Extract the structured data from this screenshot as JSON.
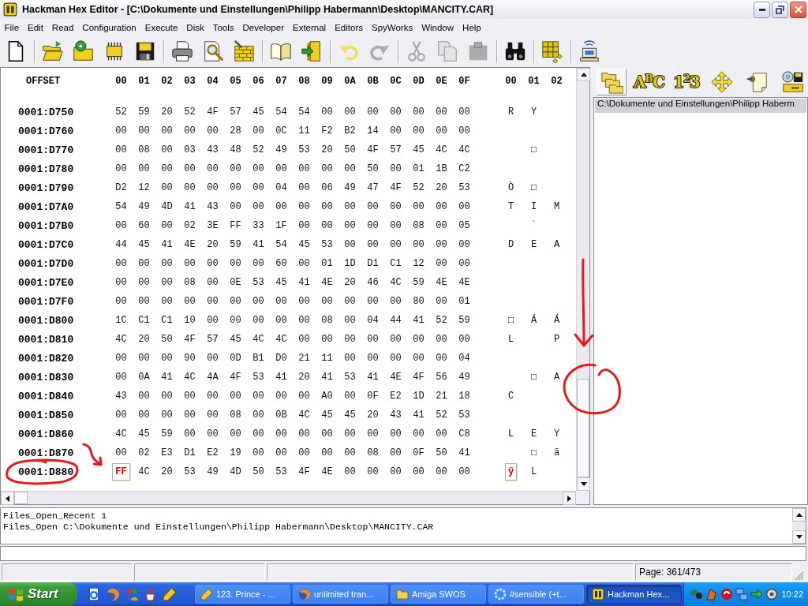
{
  "window": {
    "title": "Hackman Hex Editor - [C:\\Dokumente und Einstellungen\\Philipp Habermann\\Desktop\\MANCITY.CAR]"
  },
  "menu": [
    "File",
    "Edit",
    "Read",
    "Configuration",
    "Execute",
    "Disk",
    "Tools",
    "Developer",
    "External",
    "Editors",
    "SpyWorks",
    "Window",
    "Help"
  ],
  "toolbar": {
    "groups": [
      [
        {
          "kind": "new",
          "disabled": false
        }
      ],
      [
        {
          "kind": "open",
          "disabled": false
        },
        {
          "kind": "recent",
          "disabled": false
        },
        {
          "kind": "chip",
          "disabled": false
        },
        {
          "kind": "save",
          "disabled": false
        }
      ],
      [
        {
          "kind": "print",
          "disabled": false
        },
        {
          "kind": "inspect",
          "disabled": false
        },
        {
          "kind": "wall",
          "disabled": false
        }
      ],
      [
        {
          "kind": "book",
          "disabled": false
        },
        {
          "kind": "exit",
          "disabled": false
        }
      ],
      [
        {
          "kind": "undo",
          "disabled": false
        },
        {
          "kind": "redo",
          "disabled": true
        }
      ],
      [
        {
          "kind": "cut",
          "disabled": true
        },
        {
          "kind": "copy",
          "disabled": true
        },
        {
          "kind": "paste",
          "disabled": true
        }
      ],
      [
        {
          "kind": "find",
          "disabled": false
        }
      ],
      [
        {
          "kind": "cubes",
          "disabled": false
        }
      ],
      [
        {
          "kind": "network",
          "disabled": false
        }
      ]
    ]
  },
  "hex_view": {
    "offset_header": "OFFSET",
    "byte_columns": [
      "00",
      "01",
      "02",
      "03",
      "04",
      "05",
      "06",
      "07",
      "08",
      "09",
      "0A",
      "0B",
      "0C",
      "0D",
      "0E",
      "0F"
    ],
    "text_columns": [
      "00",
      "01",
      "02"
    ],
    "rows": [
      {
        "offset": "0001:D750",
        "bytes": [
          {
            "value": "52",
            "selected": false
          },
          {
            "value": "59",
            "selected": false
          },
          {
            "value": "20",
            "selected": false
          },
          {
            "value": "52",
            "selected": false
          },
          {
            "value": "4F",
            "selected": false
          },
          {
            "value": "57",
            "selected": false
          },
          {
            "value": "45",
            "selected": false
          },
          {
            "value": "54",
            "selected": false
          },
          {
            "value": "54",
            "selected": false
          },
          {
            "value": "00",
            "selected": false
          },
          {
            "value": "00",
            "selected": false
          },
          {
            "value": "00",
            "selected": false
          },
          {
            "value": "00",
            "selected": false
          },
          {
            "value": "00",
            "selected": false
          },
          {
            "value": "00",
            "selected": false
          },
          {
            "value": "00",
            "selected": false
          }
        ],
        "text": [
          {
            "value": "R",
            "selected": false
          },
          {
            "value": "Y",
            "selected": false
          },
          {
            "selected": false
          }
        ]
      },
      {
        "offset": "0001:D760",
        "bytes": [
          {
            "value": "00",
            "selected": false
          },
          {
            "value": "00",
            "selected": false
          },
          {
            "value": "00",
            "selected": false
          },
          {
            "value": "00",
            "selected": false
          },
          {
            "value": "00",
            "selected": false
          },
          {
            "value": "28",
            "selected": false
          },
          {
            "value": "00",
            "selected": false
          },
          {
            "value": "0C",
            "selected": false
          },
          {
            "value": "11",
            "selected": false
          },
          {
            "value": "F2",
            "selected": false
          },
          {
            "value": "B2",
            "selected": false
          },
          {
            "value": "14",
            "selected": false
          },
          {
            "value": "00",
            "selected": false
          },
          {
            "value": "00",
            "selected": false
          },
          {
            "value": "00",
            "selected": false
          },
          {
            "value": "00",
            "selected": false
          }
        ]
      },
      {
        "offset": "0001:D770",
        "bytes": [
          {
            "value": "00",
            "selected": false
          },
          {
            "value": "08",
            "selected": false
          },
          {
            "value": "00",
            "selected": false
          },
          {
            "value": "03",
            "selected": false
          },
          {
            "value": "43",
            "selected": false
          },
          {
            "value": "48",
            "selected": false
          },
          {
            "value": "52",
            "selected": false
          },
          {
            "value": "49",
            "selected": false
          },
          {
            "value": "53",
            "selected": false
          },
          {
            "value": "20",
            "selected": false
          },
          {
            "value": "50",
            "selected": false
          },
          {
            "value": "4F",
            "selected": false
          },
          {
            "value": "57",
            "selected": false
          },
          {
            "value": "45",
            "selected": false
          },
          {
            "value": "4C",
            "selected": false
          },
          {
            "value": "4C",
            "selected": false
          }
        ],
        "text": [
          {
            "selected": false
          },
          {
            "value": "□",
            "selected": false
          },
          {
            "selected": false
          }
        ]
      },
      {
        "offset": "0001:D780",
        "bytes": [
          {
            "value": "00",
            "selected": false
          },
          {
            "value": "00",
            "selected": false
          },
          {
            "value": "00",
            "selected": false
          },
          {
            "value": "00",
            "selected": false
          },
          {
            "value": "00",
            "selected": false
          },
          {
            "value": "00",
            "selected": false
          },
          {
            "value": "00",
            "selected": false
          },
          {
            "value": "00",
            "selected": false
          },
          {
            "value": "00",
            "selected": false
          },
          {
            "value": "00",
            "selected": false
          },
          {
            "value": "00",
            "selected": false
          },
          {
            "value": "50",
            "selected": false
          },
          {
            "value": "00",
            "selected": false
          },
          {
            "value": "01",
            "selected": false
          },
          {
            "value": "1B",
            "selected": false
          },
          {
            "value": "C2",
            "selected": false
          }
        ]
      },
      {
        "offset": "0001:D790",
        "bytes": [
          {
            "value": "D2",
            "selected": false
          },
          {
            "value": "12",
            "selected": false
          },
          {
            "value": "00",
            "selected": false
          },
          {
            "value": "00",
            "selected": false
          },
          {
            "value": "00",
            "selected": false
          },
          {
            "value": "00",
            "selected": false
          },
          {
            "value": "00",
            "selected": false
          },
          {
            "value": "04",
            "selected": false
          },
          {
            "value": "00",
            "selected": false
          },
          {
            "value": "06",
            "selected": false
          },
          {
            "value": "49",
            "selected": false
          },
          {
            "value": "47",
            "selected": false
          },
          {
            "value": "4F",
            "selected": false
          },
          {
            "value": "52",
            "selected": false
          },
          {
            "value": "20",
            "selected": false
          },
          {
            "value": "53",
            "selected": false
          }
        ],
        "text": [
          {
            "value": "Ò",
            "selected": false
          },
          {
            "value": "□",
            "selected": false
          },
          {
            "selected": false
          }
        ]
      },
      {
        "offset": "0001:D7A0",
        "bytes": [
          {
            "value": "54",
            "selected": false
          },
          {
            "value": "49",
            "selected": false
          },
          {
            "value": "4D",
            "selected": false
          },
          {
            "value": "41",
            "selected": false
          },
          {
            "value": "43",
            "selected": false
          },
          {
            "value": "00",
            "selected": false
          },
          {
            "value": "00",
            "selected": false
          },
          {
            "value": "00",
            "selected": false
          },
          {
            "value": "00",
            "selected": false
          },
          {
            "value": "00",
            "selected": false
          },
          {
            "value": "00",
            "selected": false
          },
          {
            "value": "00",
            "selected": false
          },
          {
            "value": "00",
            "selected": false
          },
          {
            "value": "00",
            "selected": false
          },
          {
            "value": "00",
            "selected": false
          },
          {
            "value": "00",
            "selected": false
          }
        ],
        "text": [
          {
            "value": "T",
            "selected": false
          },
          {
            "value": "I",
            "selected": false
          },
          {
            "value": "M",
            "selected": false
          }
        ]
      },
      {
        "offset": "0001:D7B0",
        "bytes": [
          {
            "value": "00",
            "selected": false
          },
          {
            "value": "60",
            "selected": false
          },
          {
            "value": "00",
            "selected": false
          },
          {
            "value": "02",
            "selected": false
          },
          {
            "value": "3E",
            "selected": false
          },
          {
            "value": "FF",
            "selected": false
          },
          {
            "value": "33",
            "selected": false
          },
          {
            "value": "1F",
            "selected": false
          },
          {
            "value": "00",
            "selected": false
          },
          {
            "value": "00",
            "selected": false
          },
          {
            "value": "00",
            "selected": false
          },
          {
            "value": "00",
            "selected": false
          },
          {
            "value": "00",
            "selected": false
          },
          {
            "value": "08",
            "selected": false
          },
          {
            "value": "00",
            "selected": false
          },
          {
            "value": "05",
            "selected": false
          }
        ],
        "text": [
          {
            "selected": false
          },
          {
            "value": "`",
            "selected": false
          },
          {
            "selected": false
          }
        ]
      },
      {
        "offset": "0001:D7C0",
        "bytes": [
          {
            "value": "44",
            "selected": false
          },
          {
            "value": "45",
            "selected": false
          },
          {
            "value": "41",
            "selected": false
          },
          {
            "value": "4E",
            "selected": false
          },
          {
            "value": "20",
            "selected": false
          },
          {
            "value": "59",
            "selected": false
          },
          {
            "value": "41",
            "selected": false
          },
          {
            "value": "54",
            "selected": false
          },
          {
            "value": "45",
            "selected": false
          },
          {
            "value": "53",
            "selected": false
          },
          {
            "value": "00",
            "selected": false
          },
          {
            "value": "00",
            "selected": false
          },
          {
            "value": "00",
            "selected": false
          },
          {
            "value": "00",
            "selected": false
          },
          {
            "value": "00",
            "selected": false
          },
          {
            "value": "00",
            "selected": false
          }
        ],
        "text": [
          {
            "value": "D",
            "selected": false
          },
          {
            "value": "E",
            "selected": false
          },
          {
            "value": "A",
            "selected": false
          }
        ]
      },
      {
        "offset": "0001:D7D0",
        "bytes": [
          {
            "value": "00",
            "selected": false
          },
          {
            "value": "00",
            "selected": false
          },
          {
            "value": "00",
            "selected": false
          },
          {
            "value": "00",
            "selected": false
          },
          {
            "value": "00",
            "selected": false
          },
          {
            "value": "00",
            "selected": false
          },
          {
            "value": "00",
            "selected": false
          },
          {
            "value": "60",
            "selected": false
          },
          {
            "value": "00",
            "selected": false
          },
          {
            "value": "01",
            "selected": false
          },
          {
            "value": "1D",
            "selected": false
          },
          {
            "value": "D1",
            "selected": false
          },
          {
            "value": "C1",
            "selected": false
          },
          {
            "value": "12",
            "selected": false
          },
          {
            "value": "00",
            "selected": false
          },
          {
            "value": "00",
            "selected": false
          }
        ]
      },
      {
        "offset": "0001:D7E0",
        "bytes": [
          {
            "value": "00",
            "selected": false
          },
          {
            "value": "00",
            "selected": false
          },
          {
            "value": "00",
            "selected": false
          },
          {
            "value": "08",
            "selected": false
          },
          {
            "value": "00",
            "selected": false
          },
          {
            "value": "0E",
            "selected": false
          },
          {
            "value": "53",
            "selected": false
          },
          {
            "value": "45",
            "selected": false
          },
          {
            "value": "41",
            "selected": false
          },
          {
            "value": "4E",
            "selected": false
          },
          {
            "value": "20",
            "selected": false
          },
          {
            "value": "46",
            "selected": false
          },
          {
            "value": "4C",
            "selected": false
          },
          {
            "value": "59",
            "selected": false
          },
          {
            "value": "4E",
            "selected": false
          },
          {
            "value": "4E",
            "selected": false
          }
        ]
      },
      {
        "offset": "0001:D7F0",
        "bytes": [
          {
            "value": "00",
            "selected": false
          },
          {
            "value": "00",
            "selected": false
          },
          {
            "value": "00",
            "selected": false
          },
          {
            "value": "00",
            "selected": false
          },
          {
            "value": "00",
            "selected": false
          },
          {
            "value": "00",
            "selected": false
          },
          {
            "value": "00",
            "selected": false
          },
          {
            "value": "00",
            "selected": false
          },
          {
            "value": "00",
            "selected": false
          },
          {
            "value": "00",
            "selected": false
          },
          {
            "value": "00",
            "selected": false
          },
          {
            "value": "00",
            "selected": false
          },
          {
            "value": "00",
            "selected": false
          },
          {
            "value": "80",
            "selected": false
          },
          {
            "value": "00",
            "selected": false
          },
          {
            "value": "01",
            "selected": false
          }
        ]
      },
      {
        "offset": "0001:D800",
        "bytes": [
          {
            "value": "1C",
            "selected": false
          },
          {
            "value": "C1",
            "selected": false
          },
          {
            "value": "C1",
            "selected": false
          },
          {
            "value": "10",
            "selected": false
          },
          {
            "value": "00",
            "selected": false
          },
          {
            "value": "00",
            "selected": false
          },
          {
            "value": "00",
            "selected": false
          },
          {
            "value": "00",
            "selected": false
          },
          {
            "value": "00",
            "selected": false
          },
          {
            "value": "08",
            "selected": false
          },
          {
            "value": "00",
            "selected": false
          },
          {
            "value": "04",
            "selected": false
          },
          {
            "value": "44",
            "selected": false
          },
          {
            "value": "41",
            "selected": false
          },
          {
            "value": "52",
            "selected": false
          },
          {
            "value": "59",
            "selected": false
          }
        ],
        "text": [
          {
            "value": "□",
            "selected": false
          },
          {
            "value": "Á",
            "selected": false
          },
          {
            "value": "Á",
            "selected": false
          }
        ]
      },
      {
        "offset": "0001:D810",
        "bytes": [
          {
            "value": "4C",
            "selected": false
          },
          {
            "value": "20",
            "selected": false
          },
          {
            "value": "50",
            "selected": false
          },
          {
            "value": "4F",
            "selected": false
          },
          {
            "value": "57",
            "selected": false
          },
          {
            "value": "45",
            "selected": false
          },
          {
            "value": "4C",
            "selected": false
          },
          {
            "value": "4C",
            "selected": false
          },
          {
            "value": "00",
            "selected": false
          },
          {
            "value": "00",
            "selected": false
          },
          {
            "value": "00",
            "selected": false
          },
          {
            "value": "00",
            "selected": false
          },
          {
            "value": "00",
            "selected": false
          },
          {
            "value": "00",
            "selected": false
          },
          {
            "value": "00",
            "selected": false
          },
          {
            "value": "00",
            "selected": false
          }
        ],
        "text": [
          {
            "value": "L",
            "selected": false
          },
          {
            "selected": false
          },
          {
            "value": "P",
            "selected": false
          }
        ]
      },
      {
        "offset": "0001:D820",
        "bytes": [
          {
            "value": "00",
            "selected": false
          },
          {
            "value": "00",
            "selected": false
          },
          {
            "value": "00",
            "selected": false
          },
          {
            "value": "90",
            "selected": false
          },
          {
            "value": "00",
            "selected": false
          },
          {
            "value": "0D",
            "selected": false
          },
          {
            "value": "B1",
            "selected": false
          },
          {
            "value": "D0",
            "selected": false
          },
          {
            "value": "21",
            "selected": false
          },
          {
            "value": "11",
            "selected": false
          },
          {
            "value": "00",
            "selected": false
          },
          {
            "value": "00",
            "selected": false
          },
          {
            "value": "00",
            "selected": false
          },
          {
            "value": "00",
            "selected": false
          },
          {
            "value": "00",
            "selected": false
          },
          {
            "value": "04",
            "selected": false
          }
        ]
      },
      {
        "offset": "0001:D830",
        "bytes": [
          {
            "value": "00",
            "selected": false
          },
          {
            "value": "0A",
            "selected": false
          },
          {
            "value": "41",
            "selected": false
          },
          {
            "value": "4C",
            "selected": false
          },
          {
            "value": "4A",
            "selected": false
          },
          {
            "value": "4F",
            "selected": false
          },
          {
            "value": "53",
            "selected": false
          },
          {
            "value": "41",
            "selected": false
          },
          {
            "value": "20",
            "selected": false
          },
          {
            "value": "41",
            "selected": false
          },
          {
            "value": "53",
            "selected": false
          },
          {
            "value": "41",
            "selected": false
          },
          {
            "value": "4E",
            "selected": false
          },
          {
            "value": "4F",
            "selected": false
          },
          {
            "value": "56",
            "selected": false
          },
          {
            "value": "49",
            "selected": false
          }
        ],
        "text": [
          {
            "selected": false
          },
          {
            "value": "□",
            "selected": false
          },
          {
            "value": "A",
            "selected": false
          }
        ]
      },
      {
        "offset": "0001:D840",
        "bytes": [
          {
            "value": "43",
            "selected": false
          },
          {
            "value": "00",
            "selected": false
          },
          {
            "value": "00",
            "selected": false
          },
          {
            "value": "00",
            "selected": false
          },
          {
            "value": "00",
            "selected": false
          },
          {
            "value": "00",
            "selected": false
          },
          {
            "value": "00",
            "selected": false
          },
          {
            "value": "00",
            "selected": false
          },
          {
            "value": "00",
            "selected": false
          },
          {
            "value": "A0",
            "selected": false
          },
          {
            "value": "00",
            "selected": false
          },
          {
            "value": "0F",
            "selected": false
          },
          {
            "value": "E2",
            "selected": false
          },
          {
            "value": "1D",
            "selected": false
          },
          {
            "value": "21",
            "selected": false
          },
          {
            "value": "18",
            "selected": false
          }
        ],
        "text": [
          {
            "value": "C",
            "selected": false
          },
          {
            "selected": false
          },
          {
            "selected": false
          }
        ]
      },
      {
        "offset": "0001:D850",
        "bytes": [
          {
            "value": "00",
            "selected": false
          },
          {
            "value": "00",
            "selected": false
          },
          {
            "value": "00",
            "selected": false
          },
          {
            "value": "00",
            "selected": false
          },
          {
            "value": "00",
            "selected": false
          },
          {
            "value": "08",
            "selected": false
          },
          {
            "value": "00",
            "selected": false
          },
          {
            "value": "0B",
            "selected": false
          },
          {
            "value": "4C",
            "selected": false
          },
          {
            "value": "45",
            "selected": false
          },
          {
            "value": "45",
            "selected": false
          },
          {
            "value": "20",
            "selected": false
          },
          {
            "value": "43",
            "selected": false
          },
          {
            "value": "41",
            "selected": false
          },
          {
            "value": "52",
            "selected": false
          },
          {
            "value": "53",
            "selected": false
          }
        ]
      },
      {
        "offset": "0001:D860",
        "bytes": [
          {
            "value": "4C",
            "selected": false
          },
          {
            "value": "45",
            "selected": false
          },
          {
            "value": "59",
            "selected": false
          },
          {
            "value": "00",
            "selected": false
          },
          {
            "value": "00",
            "selected": false
          },
          {
            "value": "00",
            "selected": false
          },
          {
            "value": "00",
            "selected": false
          },
          {
            "value": "00",
            "selected": false
          },
          {
            "value": "00",
            "selected": false
          },
          {
            "value": "00",
            "selected": false
          },
          {
            "value": "00",
            "selected": false
          },
          {
            "value": "00",
            "selected": false
          },
          {
            "value": "00",
            "selected": false
          },
          {
            "value": "00",
            "selected": false
          },
          {
            "value": "00",
            "selected": false
          },
          {
            "value": "C8",
            "selected": false
          }
        ],
        "text": [
          {
            "value": "L",
            "selected": false
          },
          {
            "value": "E",
            "selected": false
          },
          {
            "value": "Y",
            "selected": false
          }
        ]
      },
      {
        "offset": "0001:D870",
        "bytes": [
          {
            "value": "00",
            "selected": false
          },
          {
            "value": "02",
            "selected": false
          },
          {
            "value": "E3",
            "selected": false
          },
          {
            "value": "D1",
            "selected": false
          },
          {
            "value": "E2",
            "selected": false
          },
          {
            "value": "19",
            "selected": false
          },
          {
            "value": "00",
            "selected": false
          },
          {
            "value": "00",
            "selected": false
          },
          {
            "value": "00",
            "selected": false
          },
          {
            "value": "00",
            "selected": false
          },
          {
            "value": "00",
            "selected": false
          },
          {
            "value": "08",
            "selected": false
          },
          {
            "value": "00",
            "selected": false
          },
          {
            "value": "0F",
            "selected": false
          },
          {
            "value": "50",
            "selected": false
          },
          {
            "value": "41",
            "selected": false
          }
        ],
        "text": [
          {
            "selected": false
          },
          {
            "value": "□",
            "selected": false
          },
          {
            "value": "ã",
            "selected": false
          }
        ]
      },
      {
        "offset": "0001:D880",
        "bytes": [
          {
            "value": "FF",
            "selected": true
          },
          {
            "value": "4C",
            "selected": false
          },
          {
            "value": "20",
            "selected": false
          },
          {
            "value": "53",
            "selected": false
          },
          {
            "value": "49",
            "selected": false
          },
          {
            "value": "4D",
            "selected": false
          },
          {
            "value": "50",
            "selected": false
          },
          {
            "value": "53",
            "selected": false
          },
          {
            "value": "4F",
            "selected": false
          },
          {
            "value": "4E",
            "selected": false
          },
          {
            "value": "00",
            "selected": false
          },
          {
            "value": "00",
            "selected": false
          },
          {
            "value": "00",
            "selected": false
          },
          {
            "value": "00",
            "selected": false
          },
          {
            "value": "00",
            "selected": false
          },
          {
            "value": "00",
            "selected": false
          }
        ],
        "text": [
          {
            "value": "ÿ",
            "selected": true
          },
          {
            "value": "L",
            "selected": false
          },
          {
            "selected": false
          }
        ]
      }
    ]
  },
  "side_panel": {
    "tools": [
      {
        "kind": "folders",
        "selected": true
      },
      {
        "kind": "letters",
        "label": "A$^{B}$C",
        "selected": false
      },
      {
        "kind": "numbers",
        "label": "1$^{2}$3",
        "selected": false
      },
      {
        "kind": "move",
        "selected": false
      },
      {
        "kind": "note",
        "selected": false
      },
      {
        "kind": "drives",
        "selected": false
      }
    ],
    "files": [
      {
        "path": "C:\\Dokumente und Einstellungen\\Philipp Haberm",
        "selected": true
      }
    ]
  },
  "log": {
    "lines": [
      "Files_Open_Recent 1",
      "Files_Open C:\\Dokumente und Einstellungen\\Philipp Habermann\\Desktop\\MANCITY.CAR"
    ]
  },
  "status_bar": {
    "page": "Page: 361/473"
  },
  "taskbar": {
    "start": "Start",
    "tasks": [
      {
        "kind": "pencil",
        "label": "123. Prince - ...",
        "selected": false
      },
      {
        "kind": "globe",
        "label": "unlimited tran...",
        "selected": false
      },
      {
        "kind": "folder",
        "label": "Amiga SWOS",
        "selected": false
      },
      {
        "kind": "ring",
        "label": "#sensible (+t...",
        "selected": false
      },
      {
        "kind": "app",
        "label": "Hackman Hex...",
        "selected": true
      }
    ],
    "clock": "10:22"
  }
}
